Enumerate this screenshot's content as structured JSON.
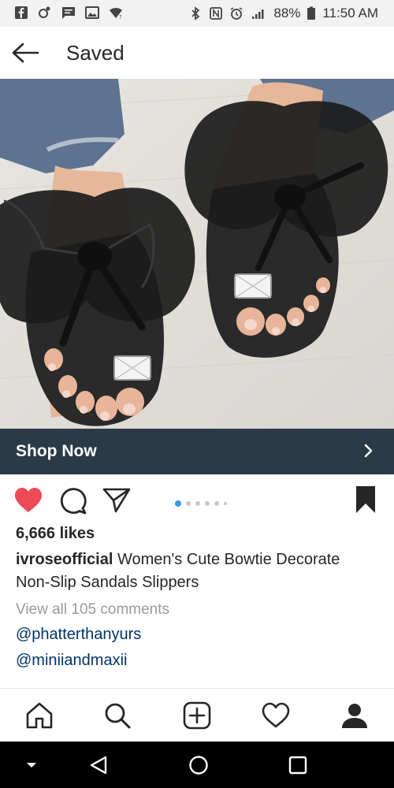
{
  "status_bar": {
    "battery": "88%",
    "time": "11:50 AM",
    "left_icons": [
      "facebook-icon",
      "game-icon",
      "message-icon",
      "gallery-icon",
      "wifi-icon"
    ],
    "right_icons": [
      "bluetooth-icon",
      "nfc-icon",
      "alarm-icon",
      "signal-icon",
      "battery-icon"
    ]
  },
  "header": {
    "title": "Saved",
    "back_icon": "arrow-left-icon"
  },
  "post": {
    "shop_now_label": "Shop Now",
    "likes": "6,666 likes",
    "username": "ivroseofficial",
    "caption": " Women's Cute Bowtie Decorate Non-Slip Sandals Slippers",
    "view_comments": "View all 105 comments",
    "mentions": [
      "@phatterthanyurs",
      "@miniiandmaxii"
    ],
    "liked": true,
    "saved": true,
    "carousel_active_index": 0,
    "carousel_count": 6
  },
  "colors": {
    "heart": "#ed4956",
    "shop_bar": "#2b3a47",
    "link": "#003569",
    "dot_active": "#3897f0"
  },
  "bottom_nav": [
    "home-icon",
    "search-icon",
    "add-icon",
    "activity-heart-icon",
    "profile-icon"
  ],
  "android_nav": [
    "keyboard-hide-icon",
    "back-icon",
    "home-circle-icon",
    "recents-icon"
  ]
}
